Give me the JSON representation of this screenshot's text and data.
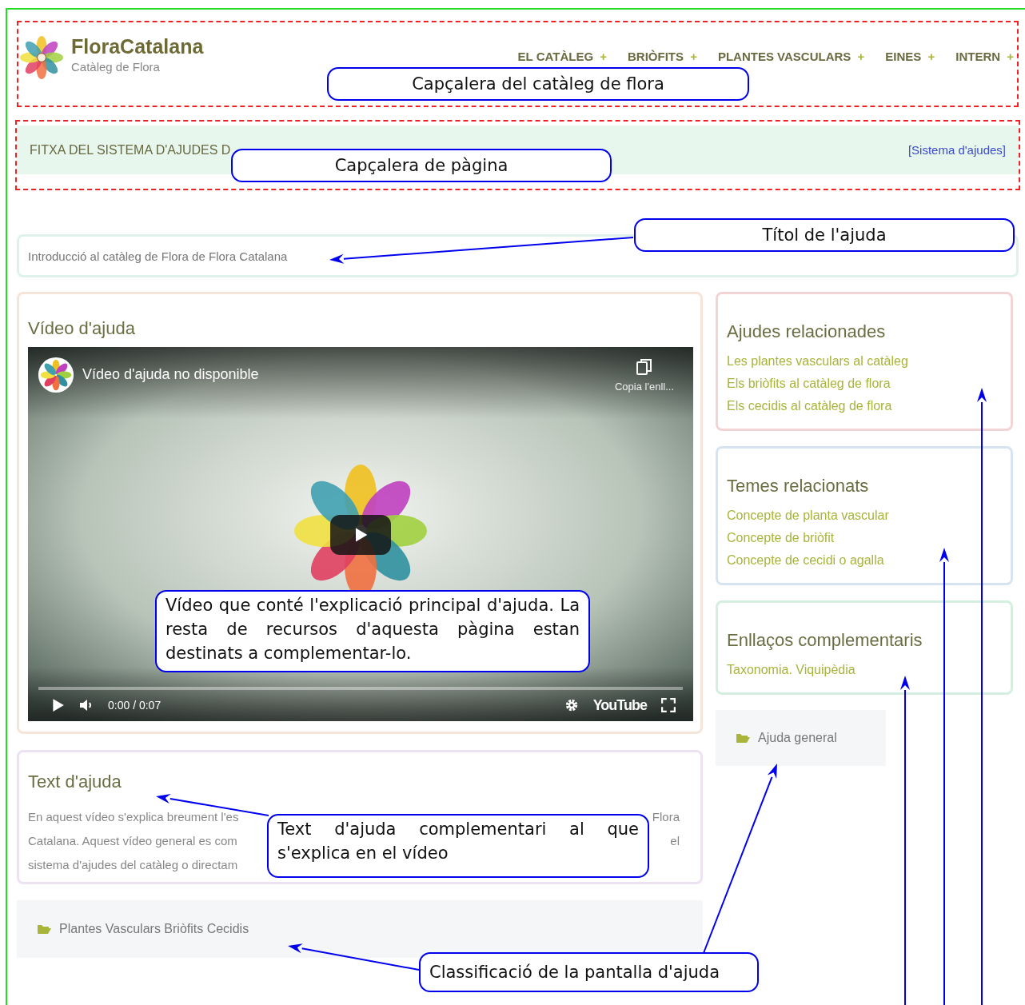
{
  "site": {
    "name": "FloraCatalana",
    "tagline": "Catàleg de Flora"
  },
  "nav": [
    {
      "label": "EL CATÀLEG",
      "expander": "+"
    },
    {
      "label": "BRIÒFITS",
      "expander": "+"
    },
    {
      "label": "PLANTES VASCULARS",
      "expander": "+"
    },
    {
      "label": "EINES",
      "expander": "+"
    },
    {
      "label": "INTERN",
      "expander": "+"
    }
  ],
  "page_header": {
    "title": "FITXA DEL SISTEMA D'AJUDES D",
    "link": "[Sistema d'ajudes]"
  },
  "help_title": "Introducció al catàleg de Flora de Flora Catalana",
  "video_panel": {
    "heading": "Vídeo d'ajuda",
    "player": {
      "title": "Vídeo d'ajuda no disponible",
      "copy_link": "Copia l'enll...",
      "time": "0:00 / 0:07",
      "brand": "YouTube"
    }
  },
  "text_panel": {
    "heading": "Text d'ajuda",
    "lines": [
      {
        "left": "En aquest vídeo s'explica breument l'es",
        "right": "Flora"
      },
      {
        "left": "Catalana. Aquest vídeo general es com",
        "right": "el"
      },
      {
        "left": "sistema d'ajudes del catàleg o directam"
      }
    ]
  },
  "classification": "Plantes Vasculars Briòfits Cecidis",
  "sidebar": [
    {
      "heading": "Ajudes relacionades",
      "color": "#f2d4d4",
      "links": [
        "Les plantes vasculars al catàleg",
        "Els briòfits al catàleg de flora",
        "Els cecidis al catàleg de flora"
      ]
    },
    {
      "heading": "Temes relacionats",
      "color": "#d6e4f2",
      "links": [
        "Concepte de planta vascular",
        "Concepte de briòfit",
        "Concepte de cecidi o agalla"
      ]
    },
    {
      "heading": "Enllaços complementaris",
      "color": "#d4eedf",
      "links": [
        "Taxonomia. Viquipèdia"
      ]
    }
  ],
  "general_help": "Ajuda general",
  "annotations": [
    "Capçalera del catàleg de flora",
    "Capçalera de pàgina",
    "Títol de l'ajuda",
    "Vídeo que conté l'explicació principal d'ajuda. La resta de recursos d'aquesta pàgina estan destinats a complementar-lo.",
    "Text d'ajuda complementari al que s'explica en el vídeo",
    "Classificació de la pantalla d'ajuda"
  ]
}
